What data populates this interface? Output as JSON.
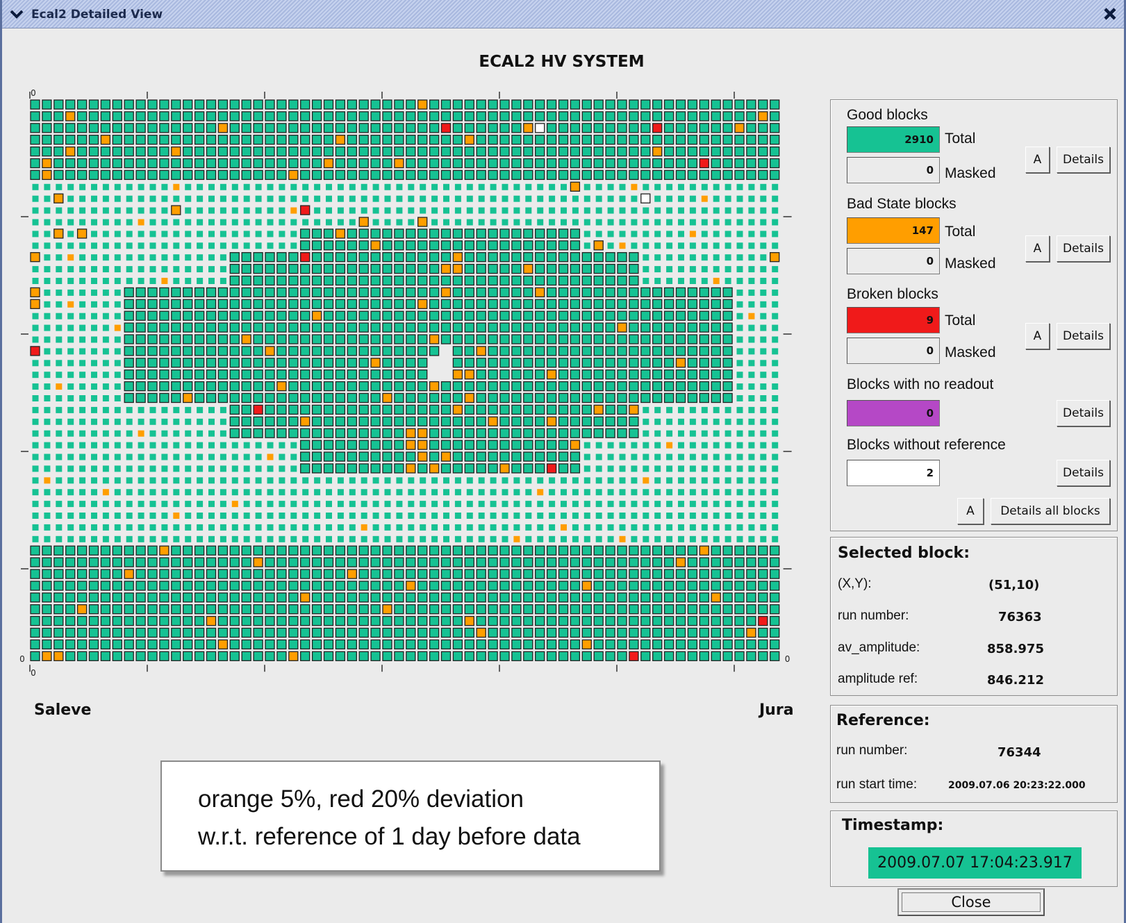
{
  "window": {
    "title": "Ecal2 Detailed View"
  },
  "plot": {
    "title": "ECAL2 HV SYSTEM",
    "left_label": "Saleve",
    "right_label": "Jura",
    "axis_zero": "0"
  },
  "colors": {
    "good": "#16c293",
    "bad_state": "#ff9e00",
    "broken": "#f01a1a",
    "no_readout": "#b548c6",
    "no_reference": "#ffffff",
    "cell_border": "#222222"
  },
  "legend": {
    "good": {
      "heading": "Good blocks",
      "total_value": "2910",
      "total_label": "Total",
      "masked_value": "0",
      "masked_label": "Masked",
      "a_label": "A",
      "details_label": "Details"
    },
    "bad": {
      "heading": "Bad State blocks",
      "total_value": "147",
      "total_label": "Total",
      "masked_value": "0",
      "masked_label": "Masked",
      "a_label": "A",
      "details_label": "Details"
    },
    "broken": {
      "heading": "Broken blocks",
      "total_value": "9",
      "total_label": "Total",
      "masked_value": "0",
      "masked_label": "Masked",
      "a_label": "A",
      "details_label": "Details"
    },
    "no_readout": {
      "heading": "Blocks with no readout",
      "value": "0",
      "details_label": "Details"
    },
    "no_reference": {
      "heading": "Blocks without reference",
      "value": "2",
      "details_label": "Details"
    },
    "all": {
      "a_label": "A",
      "details_label": "Details all blocks"
    }
  },
  "selected_block": {
    "heading": "Selected block:",
    "rows": [
      {
        "key": "(X,Y):",
        "value": "(51,10)"
      },
      {
        "key": "run number:",
        "value": "76363"
      },
      {
        "key": "av_amplitude:",
        "value": "858.975"
      },
      {
        "key": "amplitude ref:",
        "value": "846.212"
      }
    ]
  },
  "reference": {
    "heading": "Reference:",
    "rows": [
      {
        "key": "run number:",
        "value": "76344"
      },
      {
        "key": "run start time:",
        "value": "2009.07.06 20:23:22.000"
      }
    ]
  },
  "timestamp": {
    "heading": "Timestamp:",
    "value": "2009.07.07 17:04:23.917"
  },
  "close_label": "Close",
  "note": {
    "line1": "orange 5%, red 20% deviation",
    "line2": "w.r.t. reference of 1 day before data"
  },
  "grid": {
    "cols": 64,
    "rows": 48,
    "rows_from_top": [
      "GGGGGGGGGGGGGGGGGGGGGGGGGGGGGGGGGOGGGGGGGGGGGGGGGGGGGGGGGGGGGGGG",
      "GGGOGGGGGGGGGGGGGGGGGGGGGGGGGGGGGGGGGGGGGGGGGGGGGGGGGGGGGGGGGGOG",
      "GGGGGGGGGGGGGGGGGGGGGGGGGGGGGGGGGGGRGGGGGGOWGGGGGGGGGRGGGGGGOGGG",
      "GGGGGGOGGGGGGGGGGGGGGGGGGGGGGGGGGGGGGGGGGGGGGGGGGGGGGGGGGGGGGGGG",
      "GGGOGGGGGGGGOGGGGGGGGGGGGGGGGGGGGGGGGGGGGGGGGGGGGGGGGGGGGGGGGGGG",
      "GOGGGGGGGGGGGGGGGGGGGGGGGOGGGGGGGGGGGGGGGGGGGGGGGGGGGGGGGRGGGGGG",
      "GOGGGGGGGGGGGGGGGGGGGGOGGGGGGGGGGGGGGGGGGGGGGGGGGGGGGGGGGGGGGGGG",
      "LLLLLLLLLLLLLLLLLLLLLLLLLLLLLLLLLLLLLLLLLLLLLLOLLLLLLLLLLLLLLLLL",
      "LLOLLLLLLLLLLLLLLLLLLLLLLLLLLLLLLLLLLLLLLLLLLLLLLLLLWLLLLLLLLLLL",
      "LLLLLLLLLLLLOLLLLLLLLLLRLLLLLLLLLLLLLLLLLLLLLLLLLLLLLLLLLLLLLLLL",
      "LLLLLLLLLLLLLLLLLLLLLLLLLLLLOLLLLOLLLLLLLLLLLLLLLLLLLLLLLLLLLLLL",
      "LLOLOLLLLLLLLLLLLLLLLLLGGGGGGGGGGGGGGGGGGGGGGGGLLLLLLLLLLLLLLLLL",
      "LLLLLLLLLLLLLLLLLLLLLLLGGGGGGGGGGGGGGGGGGGGGGGGLOLLLLLLLLLLLLLLL",
      "OLLLLLLLLLLLLLLLLGGGGGGGGGGGGGGGGGGGGGGGGGGGGGGGGGGGLLLLLLLLLLLO",
      "LLLLLLLLLLLLLLLLLGGGGGGGGGGGGGGGGGGOOGGGGGGGGGGGGGGGLLLLLLLLLLLL",
      "LLLLLLLLLLLLLLLLLGGGGGGGGGGGGGGGGGGGGGGGGGGGGGGGGGGGLLLLLLLLLLLL",
      "OLLLLLLLGGGGGGGGGGGGGGGGGGGGGGGGGGGGGGGGGGGGGGGGGGGGGGGGGGGGLLLL",
      "OLLLLLLLGGGGGGGGGGGGGGGGGGGGGGGGGGGGGGGGGGGGGGGGGGGGGGGGGGGGLLLL",
      "LLLLLLLLGGGGGGGGGGGGGGGGGGGGGGGGGGGGGGGGGGGGGGGGGGGGGGGGGGGGLLLL",
      "LLLLLLLLGGGGGGGGGGGGGGGGGGGGGGGGGGGGGGGGGGGGGGGGGGGGGGGGGGGGLLLL",
      "LLLLLLLLGGGGGGGGGGGGGGGGGGGGGGGGGGGGGGGGGGGGGGGGGGGGGGGGGGGGLLLL",
      "RLLLLLLLGGGGGGGGGGGGGGGGGGGGGGGGGGGGGGGGGGGGGGGGGGGGGGGGGGGGLLLL",
      "LLLLLLLLGGGGGGGGGGGGGGGGGGGGGGGGGGGGGGGGGGGGGGGGGGGGGGGGGGGGLLLL",
      "LLLLLLLLGGGGGGGGGGGGGGGGGGGGGGGGGGGGGGGGGGGGGGGGGGGGGGGGGGGGLLLL",
      "LLLLLLLLGGGGGGGGGGGGGGGGGGGGGGGGGGGGGGGGGGGGGGGGGGGGGGGGGGGGLLLL",
      "LLLLLLLLGGGGGGGGGGGGGGGGGGGGGGGGGGGGGGGGGGGGGGGGGGGGGGGGGGGGLLLL",
      "LLLLLLLLLLLLLLLLLGGGGGGGGGGGGGGGGGGGGGGGGGGGGGGGGGGGLLLLLLLLLLLL",
      "LLLLLLLLLLLLLLLLLGGGGGGGGGGGGGGGGGGGGGGGGGGGGGGGGGGGLLLLLLLLLLLL",
      "LLLLLLLLLLLLLLLLLGGGGGGGGGGGGGGGGGGGGGGGGGGGGGGGGGGGLLLLLLLLLLLL",
      "LLLLLLLLLLLLLLLLLLLLLLLGGGGGGGGGGGGGGGGGGGGGGGGLLLLLLLLLLLLLLLLL",
      "LLLLLLLLLLLLLLLLLLLLLLLGGGGGGGGGGGGGGGGGGGGGGGGLLLLLLLLLLLLLLLLL",
      "LLLLLLLLLLLLLLLLLLLLLLLGGGGGGGGGGGGGGGGGGGGGGGGLLLLLLLLLLLLLLLLL",
      "LLLLLLLLLLLLLLLLLLLLLLLLLLLLLLLLLLLLLLLLLLLLLLLLLLLLLLLLLLLLLLLL",
      "LLLLLLLLLLLLLLLLLLLLLLLLLLLLLLLLLLLLLLLLLLLLLLLLLLLLLLLLLLLLLLLL",
      "LLLLLLLLLLLLLLLLLLLLLLLLLLLLLLLLLLLLLLLLLLLLLLLLLLLLLLLLLLLLLLLL",
      "LLLLLLLLLLLLLLLLLLLLLLLLLLLLLLLLLLLLLLLLLLLLLLLLLLLLLLLLLLLLLLLL",
      "LLLLLLLLLLLLLLLLLLLLLLLLLLLLLLLLLLLLLLLLLLLLLLLLLLLLLLLLLLLLLLLL",
      "LLLLLLLLLLLLLLLLLLLLLLLLLLLLLLLLLLLLLLLLLLLLLLLLLLLLLLLLLLLLLLLL",
      "GGGGGGGGGGGGGGGGGGGGGGGGGGGGGGGGGGGGGGGGGGGGGGGGGGGGGGGGGGGGGGGG",
      "GGGGGGGGGGGGGGGGGGGGGGGGGGGGGGGGGGGGGGGGGGGGGGGGGGGGGGGGGGGGGGGG",
      "GGGGGGGGGGGGGGGGGGGGGGGGGGGGGGGGGGGGGGGGGGGGGGGGGGGGGGGGGGGGGGGG",
      "GGGGGGGGGGGGGGGGGGGGGGGGGGGGGGGGGGGGGGGGGGGGGGGGGGGGGGGGGGGGGGGG",
      "GGGGGGGGGGGGGGGGGGGGGGGGGGGGGGGGGGGGGGGGGGGGGGGGGGGGGGGGGGGGGGGG",
      "GGGGGGGGGGGGGGGGGGGGGGGGGGGGGGGGGGGGGGGGGGGGGGGGGGGGGGGGGGGGGGGG",
      "GGGGGGGGGGGGGGGGGGGGGGGGGGGGGGGGGGGGGGGGGGGGGGGGGGGGGGGGGGGGGGGG",
      "GGGGGGGGGGGGGGGGGGGGGGGGGGGGGGGGGGGGGGGGGGGGGGGGGGGGGGGGGGGGGGGG",
      "GGGGGGGGGGGGGGGGGGGGGGGGGGGGGGGGGGGGGGGGGGGGGGGGGGGGGGGGGGGGGGGG",
      "GOOGGGGGGGGGGGGGGGGGGGGGGGGGGGGGGGGGGGGGGGGGGGGGGGGRGGGGGGGGGGGG"
    ],
    "extra_orange": [
      [
        2,
        16
      ],
      [
        3,
        37
      ],
      [
        4,
        53
      ],
      [
        7,
        12
      ],
      [
        7,
        51
      ],
      [
        9,
        22
      ],
      [
        11,
        26
      ],
      [
        12,
        29
      ],
      [
        13,
        36
      ],
      [
        15,
        58
      ],
      [
        16,
        43
      ],
      [
        18,
        61
      ],
      [
        19,
        7
      ],
      [
        20,
        18
      ],
      [
        21,
        20
      ],
      [
        22,
        29
      ],
      [
        23,
        44
      ],
      [
        24,
        2
      ],
      [
        25,
        13
      ],
      [
        26,
        48
      ],
      [
        27,
        23
      ],
      [
        29,
        54
      ],
      [
        30,
        35
      ],
      [
        31,
        40
      ],
      [
        32,
        1
      ],
      [
        33,
        6
      ],
      [
        34,
        17
      ],
      [
        36,
        45
      ],
      [
        37,
        50
      ],
      [
        38,
        11
      ],
      [
        39,
        55
      ],
      [
        40,
        27
      ],
      [
        41,
        32
      ],
      [
        42,
        58
      ],
      [
        43,
        4
      ],
      [
        44,
        15
      ],
      [
        45,
        38
      ],
      [
        46,
        47
      ],
      [
        3,
        26
      ],
      [
        5,
        31
      ],
      [
        8,
        57
      ],
      [
        10,
        9
      ],
      [
        14,
        42
      ],
      [
        17,
        3
      ],
      [
        20,
        34
      ],
      [
        21,
        38
      ],
      [
        22,
        55
      ],
      [
        24,
        21
      ],
      [
        25,
        30
      ],
      [
        26,
        36
      ],
      [
        27,
        39
      ],
      [
        28,
        9
      ],
      [
        29,
        46
      ],
      [
        30,
        20
      ],
      [
        31,
        34
      ],
      [
        32,
        52
      ],
      [
        33,
        43
      ],
      [
        35,
        12
      ],
      [
        36,
        28
      ],
      [
        37,
        41
      ],
      [
        38,
        57
      ],
      [
        39,
        19
      ],
      [
        40,
        8
      ],
      [
        41,
        47
      ],
      [
        42,
        23
      ],
      [
        43,
        30
      ],
      [
        44,
        37
      ],
      [
        45,
        61
      ],
      [
        46,
        16
      ],
      [
        47,
        22
      ],
      [
        11,
        56
      ],
      [
        12,
        50
      ],
      [
        13,
        3
      ],
      [
        15,
        11
      ],
      [
        16,
        35
      ],
      [
        17,
        33
      ],
      [
        18,
        24
      ],
      [
        19,
        50
      ],
      [
        23,
        36
      ],
      [
        23,
        37
      ],
      [
        24,
        34
      ],
      [
        25,
        37
      ],
      [
        26,
        51
      ],
      [
        27,
        44
      ],
      [
        28,
        32
      ],
      [
        28,
        33
      ],
      [
        29,
        32
      ],
      [
        29,
        33
      ],
      [
        30,
        33
      ],
      [
        31,
        32
      ]
    ],
    "extra_red": [
      [
        13,
        23
      ],
      [
        26,
        19
      ],
      [
        31,
        44
      ],
      [
        44,
        62
      ]
    ],
    "hole_cells": [
      [
        22,
        34
      ],
      [
        22,
        35
      ],
      [
        23,
        34
      ],
      [
        23,
        35
      ],
      [
        21,
        35
      ]
    ]
  }
}
